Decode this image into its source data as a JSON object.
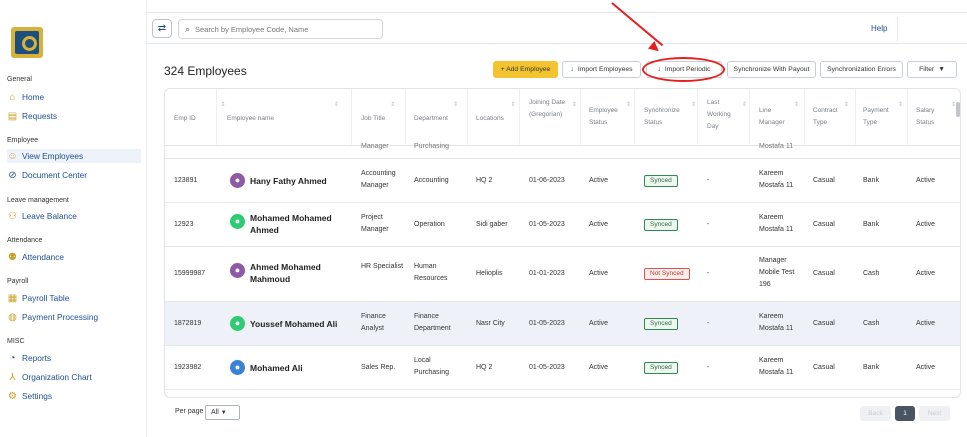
{
  "sidebar": {
    "sections": [
      {
        "label": "General",
        "items": [
          {
            "label": "Home",
            "icon": "home-icon"
          },
          {
            "label": "Requests",
            "icon": "requests-icon"
          }
        ]
      },
      {
        "label": "Employee",
        "items": [
          {
            "label": "View Employees",
            "icon": "user-icon"
          },
          {
            "label": "Document Center",
            "icon": "document-icon"
          }
        ]
      },
      {
        "label": "Leave management",
        "items": [
          {
            "label": "Leave Balance",
            "icon": "leave-icon"
          }
        ]
      },
      {
        "label": "Attendance",
        "items": [
          {
            "label": "Attendance",
            "icon": "attendance-icon"
          }
        ]
      },
      {
        "label": "Payroll",
        "items": [
          {
            "label": "Payroll Table",
            "icon": "table-icon"
          },
          {
            "label": "Payment Processing",
            "icon": "payment-icon"
          }
        ]
      },
      {
        "label": "MISC",
        "items": [
          {
            "label": "Reports",
            "icon": "reports-icon"
          },
          {
            "label": "Organization Chart",
            "icon": "org-chart-icon"
          },
          {
            "label": "Settings",
            "icon": "gear-icon"
          }
        ]
      }
    ]
  },
  "topbar": {
    "search_placeholder": "Search by Employee Code, Name",
    "help": "Help"
  },
  "page": {
    "title": "324 Employees"
  },
  "toolbar": {
    "add_employee": "+ Add Employee",
    "import_employees": "Import Employees",
    "import_periodic": "Import Periodic",
    "sync_payout": "Synchronize With Payout",
    "sync_errors": "Synchronization Errors",
    "filter": "Filter"
  },
  "table": {
    "headers": [
      "Emp ID",
      "Employee name",
      "Job Title",
      "Department",
      "Locations",
      "Joining Date (Gregorian)",
      "Employee Status",
      "Synchronize Status",
      "Last Working Day",
      "Line Manager",
      "Contract Type",
      "Payment Type",
      "Salary Status"
    ],
    "partial_row": {
      "job": "Manager",
      "dept": "Purchasing",
      "manager": "Mostafa 11"
    },
    "rows": [
      {
        "id": "123891",
        "name": "Hany Fathy Ahmed",
        "avatar_color": "#8e5aa8",
        "job": "Accounting Manager",
        "dept": "Accounting",
        "loc": "HQ 2",
        "date": "01-06-2023",
        "status": "Active",
        "sync": "Synced",
        "last": "-",
        "manager": "Kareem Mostafa 11",
        "contract": "Casual",
        "payment": "Bank",
        "salary": "Active"
      },
      {
        "id": "12923",
        "name": "Mohamed Mohamed Ahmed",
        "avatar_color": "#2ecc71",
        "job": "Project Manager",
        "dept": "Operation",
        "loc": "Sidi gaber",
        "date": "01-05-2023",
        "status": "Active",
        "sync": "Synced",
        "last": "-",
        "manager": "Kareem Mostafa 11",
        "contract": "Casual",
        "payment": "Bank",
        "salary": "Active"
      },
      {
        "id": "15999987",
        "name": "Ahmed Mohamed Mahmoud",
        "avatar_color": "#8e5aa8",
        "job": "HR Specialist",
        "dept": "Human Resources",
        "loc": "Helioplis",
        "date": "01-01-2023",
        "status": "Active",
        "sync": "Not Synced",
        "last": "-",
        "manager": "Manager Mobile Test 196",
        "contract": "Casual",
        "payment": "Cash",
        "salary": "Active"
      },
      {
        "id": "1872819",
        "name": "Youssef Mohamed Ali",
        "avatar_color": "#2ecc71",
        "job": "Finance Analyst",
        "dept": "Finance Department",
        "loc": "Nasr City",
        "date": "01-05-2023",
        "status": "Active",
        "sync": "Synced",
        "last": "-",
        "manager": "Kareem Mostafa 11",
        "contract": "Casual",
        "payment": "Cash",
        "salary": "Active"
      },
      {
        "id": "1923982",
        "name": "Mohamed Ali",
        "avatar_color": "#3b82d6",
        "job": "Sales Rep.",
        "dept": "Local Purchasing",
        "loc": "HQ 2",
        "date": "01-05-2023",
        "status": "Active",
        "sync": "Synced",
        "last": "-",
        "manager": "Kareem Mostafa 11",
        "contract": "Casual",
        "payment": "Bank",
        "salary": "Active"
      }
    ]
  },
  "footer": {
    "per_page_label": "Per page",
    "per_page_value": "All",
    "prev": "Back",
    "current_page": "1",
    "next": "Next"
  }
}
